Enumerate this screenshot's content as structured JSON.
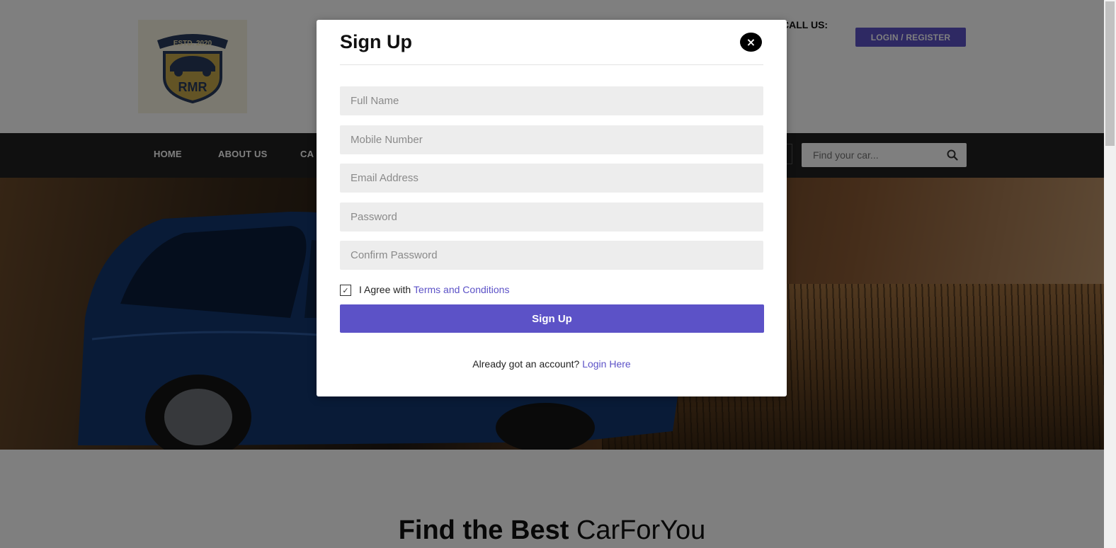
{
  "header": {
    "call_label": "CALL US:",
    "login_register": "LOGIN / REGISTER",
    "logo": {
      "top_text": "ESTD. 2020",
      "brand": "RMR"
    }
  },
  "nav": {
    "items": [
      "HOME",
      "ABOUT US",
      "CA"
    ],
    "search_placeholder": "Find your car..."
  },
  "section": {
    "title_strong": "Find the Best",
    "title_light": "CarForYou"
  },
  "modal": {
    "title": "Sign Up",
    "close_symbol": "×",
    "fields": {
      "full_name": "Full Name",
      "mobile": "Mobile Number",
      "email": "Email Address",
      "password": "Password",
      "confirm_password": "Confirm Password"
    },
    "agree_text": "I Agree with",
    "terms_link": "Terms and Conditions",
    "checkbox_mark": "✓",
    "submit_label": "Sign Up",
    "already_text": "Already got an account?",
    "login_link": "Login Here"
  },
  "colors": {
    "accent": "#5c52c7",
    "nav_bg": "#202020",
    "field_bg": "#ededed"
  }
}
